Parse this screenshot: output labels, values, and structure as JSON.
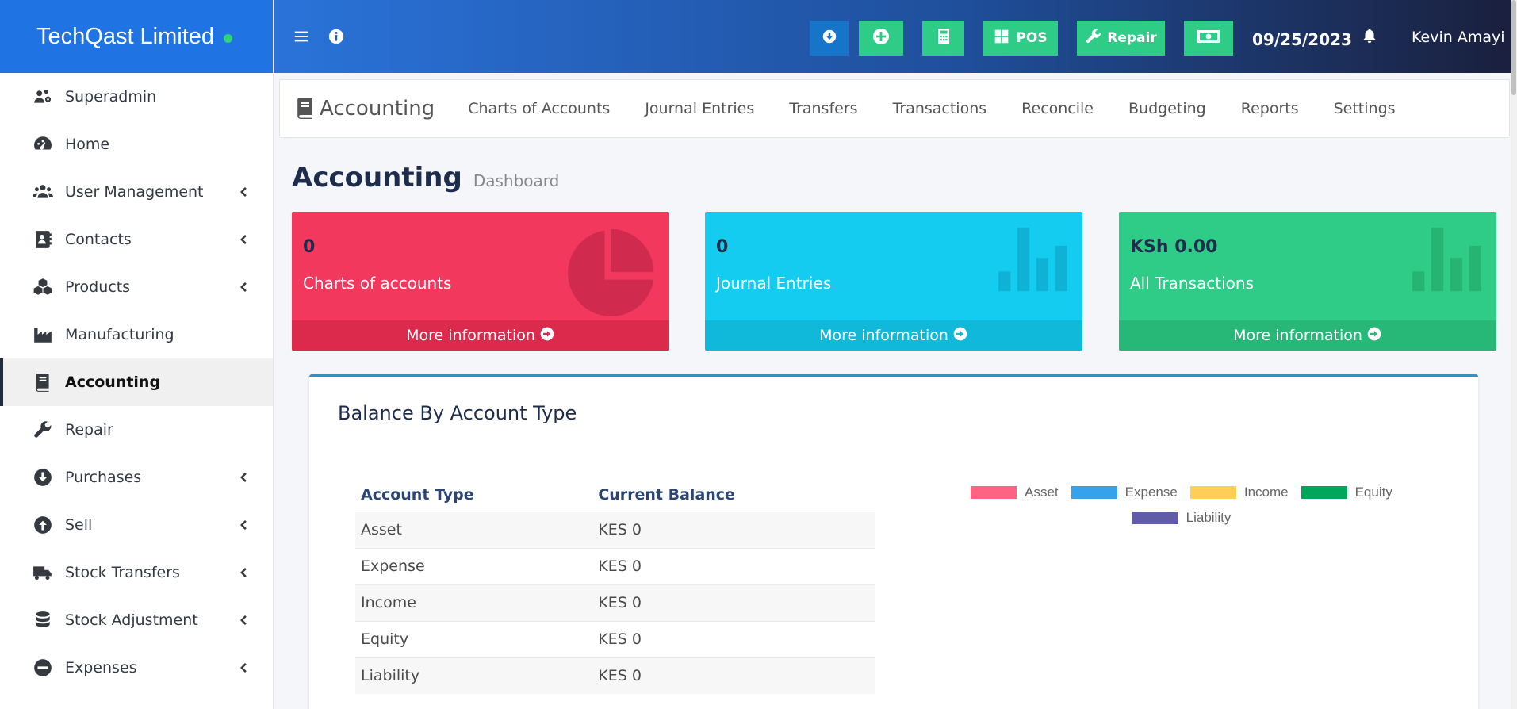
{
  "brand": {
    "name": "TechQast Limited",
    "status_color": "#2ed47a"
  },
  "sidebar": {
    "items": [
      {
        "label": "Superadmin",
        "icon": "users-cog-icon",
        "submenu": false
      },
      {
        "label": "Home",
        "icon": "tachometer-icon",
        "submenu": false
      },
      {
        "label": "User Management",
        "icon": "users-icon",
        "submenu": true
      },
      {
        "label": "Contacts",
        "icon": "address-book-icon",
        "submenu": true
      },
      {
        "label": "Products",
        "icon": "cubes-icon",
        "submenu": true
      },
      {
        "label": "Manufacturing",
        "icon": "industry-icon",
        "submenu": false
      },
      {
        "label": "Accounting",
        "icon": "book-icon",
        "submenu": false,
        "active": true
      },
      {
        "label": "Repair",
        "icon": "wrench-icon",
        "submenu": false
      },
      {
        "label": "Purchases",
        "icon": "arrow-circle-down-icon",
        "submenu": true
      },
      {
        "label": "Sell",
        "icon": "arrow-circle-up-icon",
        "submenu": true
      },
      {
        "label": "Stock Transfers",
        "icon": "truck-icon",
        "submenu": true
      },
      {
        "label": "Stock Adjustment",
        "icon": "database-icon",
        "submenu": true
      },
      {
        "label": "Expenses",
        "icon": "minus-circle-icon",
        "submenu": true
      }
    ]
  },
  "topbar": {
    "pos_label": "POS",
    "repair_label": "Repair",
    "date": "09/25/2023",
    "user": "Kevin Amayi"
  },
  "subnav": {
    "title": "Accounting",
    "links": [
      "Charts of Accounts",
      "Journal Entries",
      "Transfers",
      "Transactions",
      "Reconcile",
      "Budgeting",
      "Reports",
      "Settings"
    ]
  },
  "page": {
    "title": "Accounting",
    "subtitle": "Dashboard"
  },
  "boxes": [
    {
      "value": "0",
      "caption": "Charts of accounts",
      "footer": "More information",
      "color": "#f2385c"
    },
    {
      "value": "0",
      "caption": "Journal Entries",
      "footer": "More information",
      "color": "#13ccf0"
    },
    {
      "value": "KSh 0.00",
      "caption": "All Transactions",
      "footer": "More information",
      "color": "#2ecc87"
    }
  ],
  "balance": {
    "title": "Balance By Account Type",
    "headers": [
      "Account Type",
      "Current Balance"
    ],
    "rows": [
      [
        "Asset",
        "KES 0"
      ],
      [
        "Expense",
        "KES 0"
      ],
      [
        "Income",
        "KES 0"
      ],
      [
        "Equity",
        "KES 0"
      ],
      [
        "Liability",
        "KES 0"
      ]
    ]
  },
  "chart_data": {
    "type": "pie",
    "categories": [
      "Asset",
      "Expense",
      "Income",
      "Equity",
      "Liability"
    ],
    "values": [
      0,
      0,
      0,
      0,
      0
    ],
    "colors": [
      "#ff6384",
      "#36a2eb",
      "#ffce56",
      "#00a65a",
      "#605ca8"
    ],
    "legend": "top"
  }
}
